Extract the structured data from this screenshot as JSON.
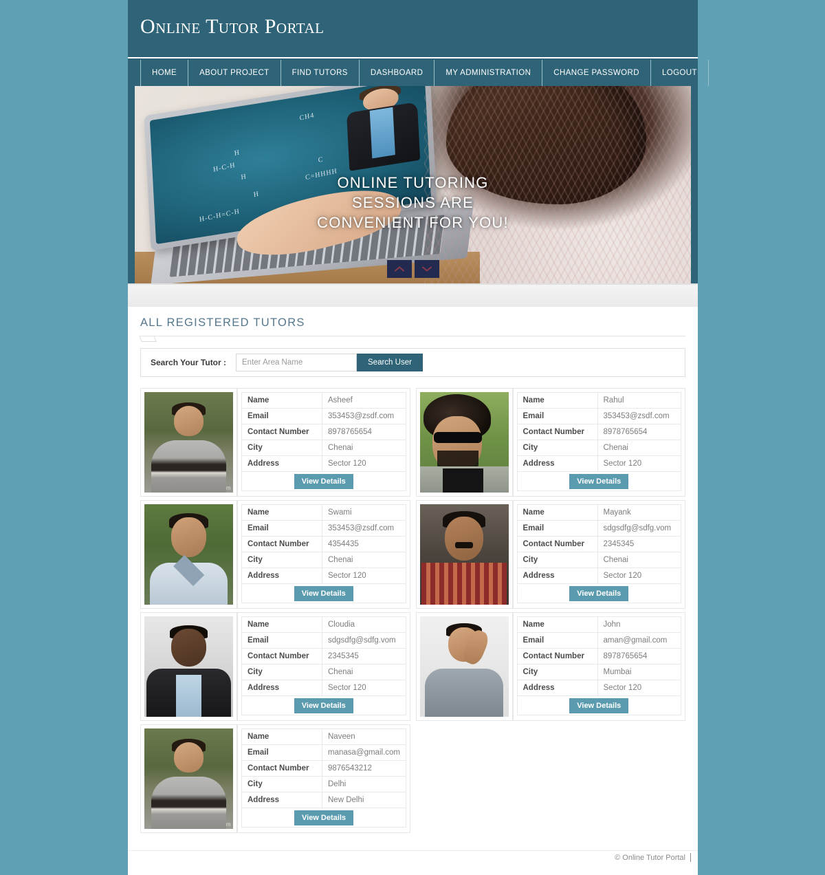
{
  "site": {
    "brand": "Online Tutor Portal",
    "footer_text": "© Online Tutor Portal"
  },
  "colors": {
    "page_background": "#5fa0b4",
    "header": "#2e6378",
    "accent_button": "#5b9bb0",
    "search_button": "#2e6378",
    "heading_text": "#54778c",
    "carousel_button": "#222a50"
  },
  "nav": {
    "items": [
      {
        "label": "HOME"
      },
      {
        "label": "ABOUT PROJECT"
      },
      {
        "label": "FIND TUTORS"
      },
      {
        "label": "DASHBOARD"
      },
      {
        "label": "MY ADMINISTRATION"
      },
      {
        "label": "CHANGE PASSWORD"
      },
      {
        "label": "LOGOUT"
      }
    ]
  },
  "hero": {
    "caption_line1": "ONLINE TUTORING",
    "caption_line2": "SESSIONS ARE",
    "caption_line3": "CONVENIENT FOR YOU!",
    "chalk_1": "CH4",
    "chalk_2": "H",
    "chalk_3": "H-C-H",
    "chalk_4": "H",
    "chalk_5": "C",
    "chalk_6": "C=HHHH",
    "chalk_7": "H",
    "chalk_8": "H-C-H=C-H",
    "prev_icon": "chevron-up-icon",
    "next_icon": "chevron-down-icon"
  },
  "main": {
    "section_title": "ALL REGISTERED TUTORS",
    "search": {
      "label": "Search Your Tutor :",
      "placeholder": "Enter Area Name",
      "value": "",
      "button_label": "Search User"
    },
    "field_labels": {
      "name": "Name",
      "email": "Email",
      "contact": "Contact Number",
      "city": "City",
      "address": "Address"
    },
    "view_details_label": "View Details",
    "photo_watermark": "dreamstime.com",
    "tutors": [
      {
        "name": "Asheef",
        "email": "353453@zsdf.com",
        "contact": "8978765654",
        "city": "Chenai",
        "address": "Sector 120",
        "photo_class": "ph-asheef",
        "watermark": true
      },
      {
        "name": "Rahul",
        "email": "353453@zsdf.com",
        "contact": "8978765654",
        "city": "Chenai",
        "address": "Sector 120",
        "photo_class": "ph-rahul",
        "watermark": false
      },
      {
        "name": "Swami",
        "email": "353453@zsdf.com",
        "contact": "4354435",
        "city": "Chenai",
        "address": "Sector 120",
        "photo_class": "ph-swami",
        "watermark": false
      },
      {
        "name": "Mayank",
        "email": "sdgsdfg@sdfg.vom",
        "contact": "2345345",
        "city": "Chenai",
        "address": "Sector 120",
        "photo_class": "ph-mayank",
        "watermark": false
      },
      {
        "name": "Cloudia",
        "email": "sdgsdfg@sdfg.vom",
        "contact": "2345345",
        "city": "Chenai",
        "address": "Sector 120",
        "photo_class": "ph-cloudia",
        "watermark": false
      },
      {
        "name": "John",
        "email": "aman@gmail.com",
        "contact": "8978765654",
        "city": "Mumbai",
        "address": "Sector 120",
        "photo_class": "ph-john",
        "watermark": false
      },
      {
        "name": "Naveen",
        "email": "manasa@gmail.com",
        "contact": "9876543212",
        "city": "Delhi",
        "address": "New Delhi",
        "photo_class": "ph-asheef",
        "watermark": true
      }
    ]
  }
}
